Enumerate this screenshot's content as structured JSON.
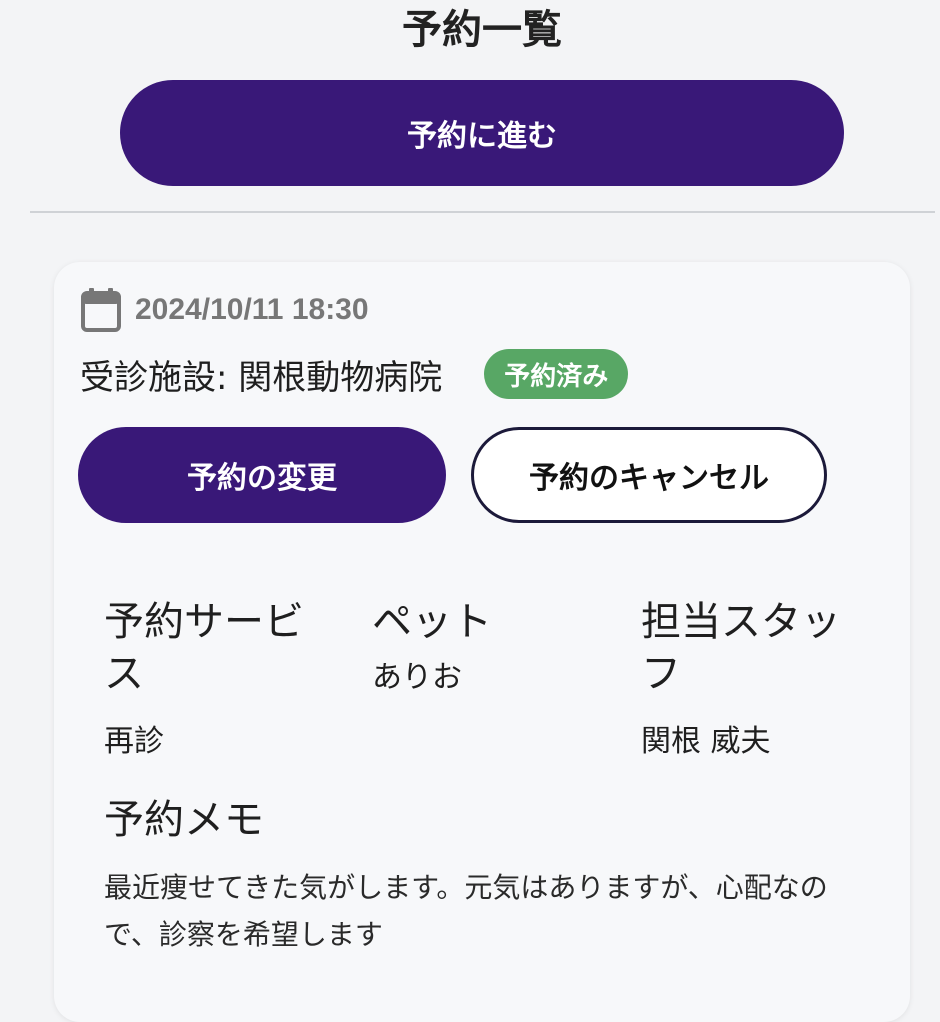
{
  "header": {
    "title": "予約一覧",
    "proceed_label": "予約に進む"
  },
  "reservation": {
    "calendar_icon": "calendar-icon",
    "datetime": "2024/10/11 18:30",
    "facility": "受診施設: 関根動物病院",
    "status": "予約済み",
    "status_color": "#58a765",
    "change_label": "予約の変更",
    "cancel_label": "予約のキャンセル",
    "service_label": "予約サービス",
    "service_value": "再診",
    "pet_label": "ペット",
    "pet_value": "ありお",
    "staff_label": "担当スタッフ",
    "staff_value": "関根 威夫",
    "memo_label": "予約メモ",
    "memo_text": "最近痩せてきた気がします。元気はありますが、心配なので、診察を希望します"
  },
  "colors": {
    "primary": "#391878",
    "background": "#f3f4f6",
    "card": "#f7f8fa"
  }
}
